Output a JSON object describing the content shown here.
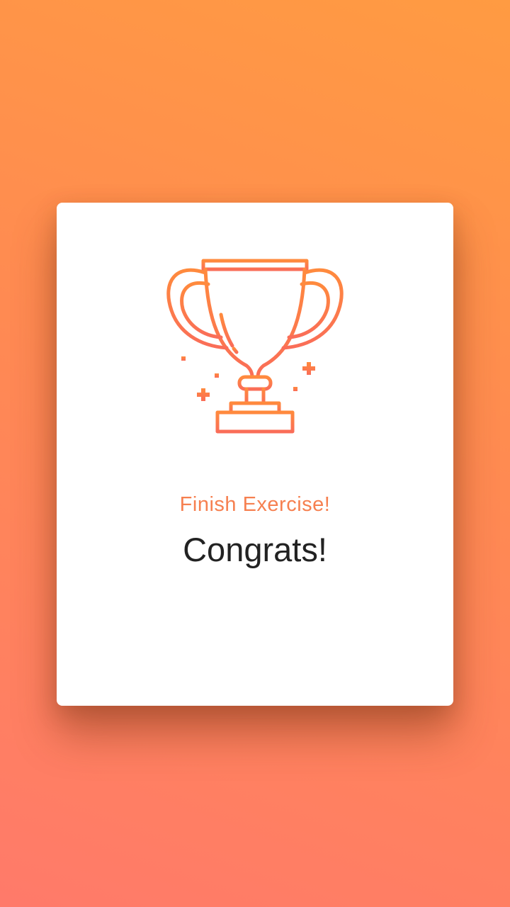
{
  "card": {
    "subtitle": "Finish Exercise!",
    "title": "Congrats!",
    "icon": "trophy-icon"
  },
  "colors": {
    "background_top": "#ff9b42",
    "background_bottom": "#ff7a6a",
    "accent": "#f68050",
    "title_text": "#222222",
    "card": "#ffffff"
  }
}
